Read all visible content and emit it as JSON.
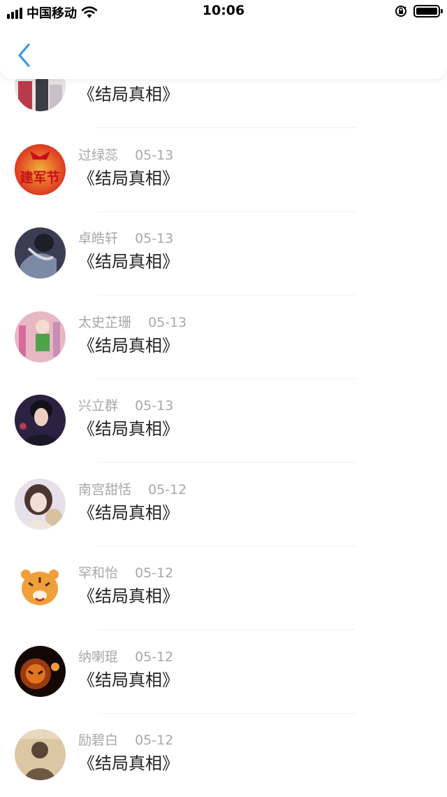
{
  "status_bar": {
    "carrier": "中国移动",
    "time": "10:06"
  },
  "header": {
    "back_icon": "chevron-left-icon",
    "accent_color": "#3a9bdc"
  },
  "comments": [
    {
      "name": "",
      "date": "",
      "title": "《结局真相》"
    },
    {
      "name": "过绿蕊",
      "date": "05-13",
      "title": "《结局真相》"
    },
    {
      "name": "卓皓轩",
      "date": "05-13",
      "title": "《结局真相》"
    },
    {
      "name": "太史芷珊",
      "date": "05-13",
      "title": "《结局真相》"
    },
    {
      "name": "兴立群",
      "date": "05-13",
      "title": "《结局真相》"
    },
    {
      "name": "南宫甜恬",
      "date": "05-12",
      "title": "《结局真相》"
    },
    {
      "name": "罕和怡",
      "date": "05-12",
      "title": "《结局真相》"
    },
    {
      "name": "纳喇琨",
      "date": "05-12",
      "title": "《结局真相》"
    },
    {
      "name": "励碧白",
      "date": "05-12",
      "title": "《结局真相》"
    }
  ],
  "avatar_labels": {
    "jianjunjie": "建军节"
  }
}
